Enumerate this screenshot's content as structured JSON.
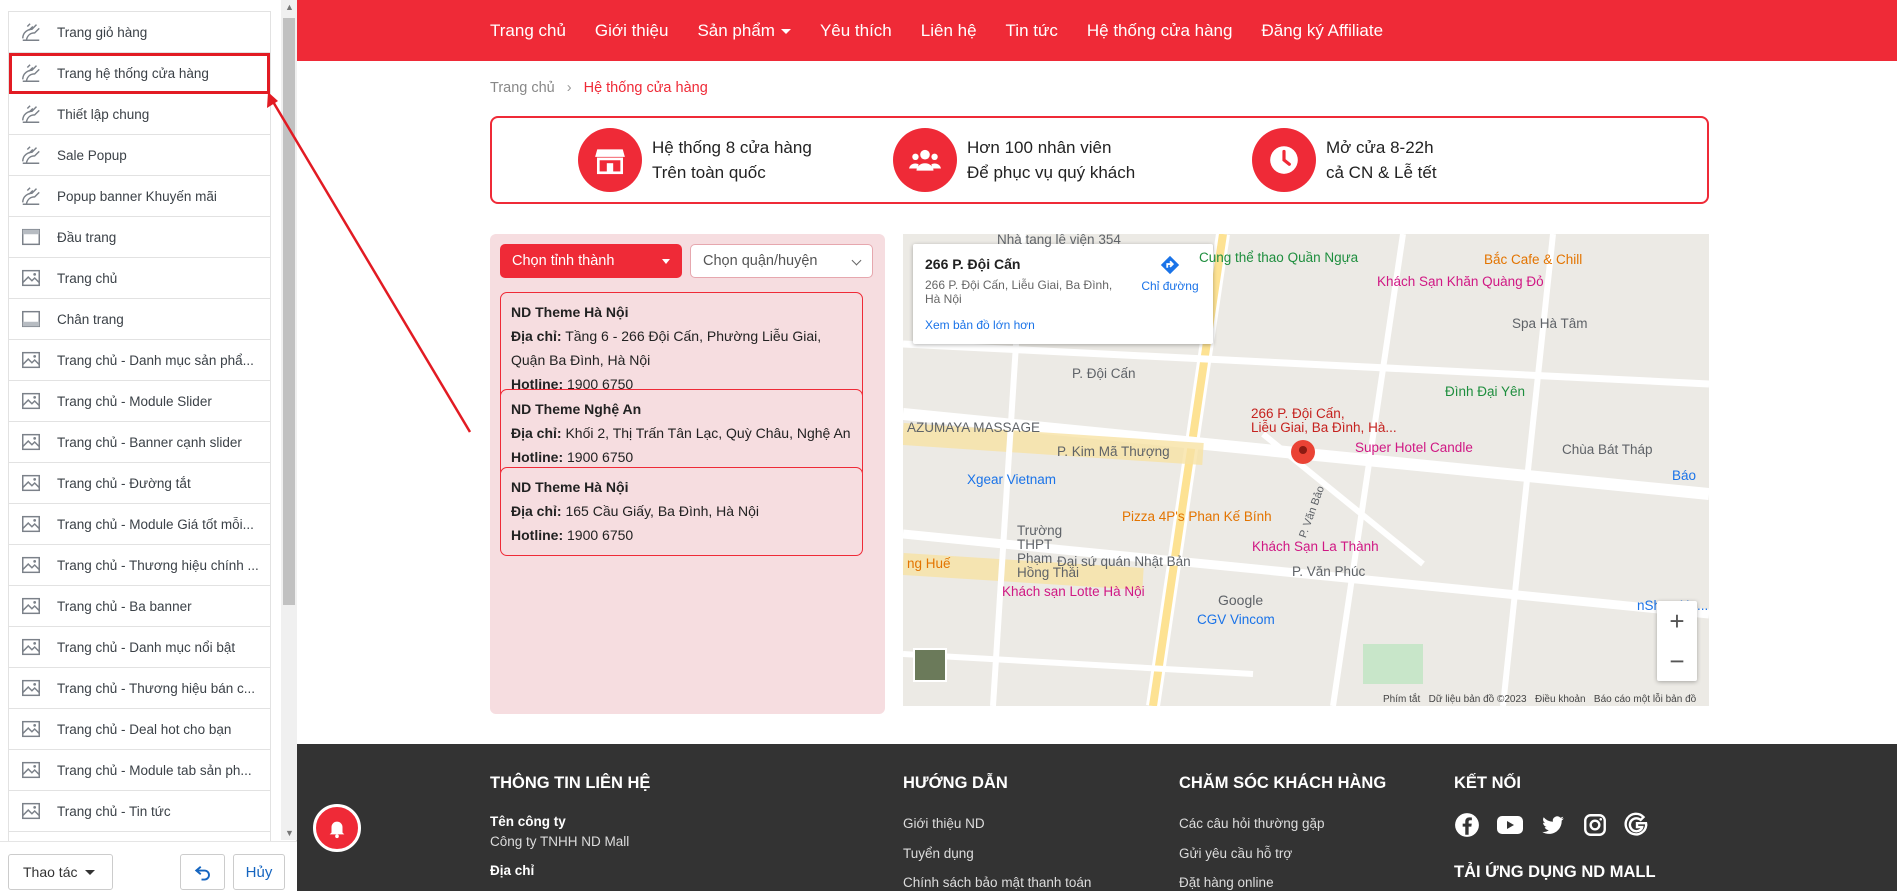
{
  "sidebar": {
    "sections": [
      {
        "label": "Trang giỏ hàng",
        "icon": "layout-icon"
      },
      {
        "label": "Trang hệ thống cửa hàng",
        "icon": "layout-icon"
      },
      {
        "label": "Thiết lập chung",
        "icon": "layout-icon"
      },
      {
        "label": "Sale Popup",
        "icon": "layout-icon"
      },
      {
        "label": "Popup banner Khuyến mãi",
        "icon": "layout-icon"
      },
      {
        "label": "Đầu trang",
        "icon": "header-icon"
      },
      {
        "label": "Trang chủ",
        "icon": "image-icon"
      },
      {
        "label": "Chân trang",
        "icon": "footer-icon"
      },
      {
        "label": "Trang chủ - Danh mục sản phẩ...",
        "icon": "image-icon"
      },
      {
        "label": "Trang chủ - Module Slider",
        "icon": "image-icon"
      },
      {
        "label": "Trang chủ - Banner cạnh slider",
        "icon": "image-icon"
      },
      {
        "label": "Trang chủ - Đường tắt",
        "icon": "image-icon"
      },
      {
        "label": "Trang chủ - Module Giá tốt mỗi...",
        "icon": "image-icon"
      },
      {
        "label": "Trang chủ - Thương hiệu chính ...",
        "icon": "image-icon"
      },
      {
        "label": "Trang chủ - Ba banner",
        "icon": "image-icon"
      },
      {
        "label": "Trang chủ - Danh mục nổi bật",
        "icon": "image-icon"
      },
      {
        "label": "Trang chủ - Thương hiệu bán c...",
        "icon": "image-icon"
      },
      {
        "label": "Trang chủ - Deal hot cho bạn",
        "icon": "image-icon"
      },
      {
        "label": "Trang chủ - Module tab sản ph...",
        "icon": "image-icon"
      },
      {
        "label": "Trang chủ - Tin tức",
        "icon": "image-icon"
      }
    ],
    "highlighted": "Trang hệ thống cửa hàng",
    "actions_label": "Thao tác",
    "cancel_label": "Hủy"
  },
  "nav": {
    "items": [
      "Trang chủ",
      "Giới thiệu",
      "Sản phẩm",
      "Yêu thích",
      "Liên hệ",
      "Tin tức",
      "Hệ thống cửa hàng",
      "Đăng ký Affiliate"
    ]
  },
  "breadcrumb": {
    "home": "Trang chủ",
    "separator": "›",
    "current": "Hệ thống cửa hàng"
  },
  "features": [
    {
      "line1": "Hệ thống 8 cửa hàng",
      "line2": "Trên toàn quốc",
      "icon": "store-icon"
    },
    {
      "line1": "Hơn 100 nhân viên",
      "line2": "Để phục vụ quý khách",
      "icon": "users-icon"
    },
    {
      "line1": "Mở cửa 8-22h",
      "line2": "cả CN & Lễ tết",
      "icon": "clock-icon"
    }
  ],
  "store_filter": {
    "province_placeholder": "Chọn tỉnh thành",
    "district_placeholder": "Chọn quận/huyện"
  },
  "stores": [
    {
      "name": "ND Theme Hà Nội",
      "address_label": "Địa chỉ:",
      "address": "Tầng 6 - 266 Đội Cấn, Phường Liễu Giai, Quận Ba Đình, Hà Nội",
      "hotline_label": "Hotline:",
      "hotline": "1900 6750"
    },
    {
      "name": "ND Theme Nghệ An",
      "address_label": "Địa chỉ:",
      "address": "Khối 2, Thị Trấn Tân Lạc, Quỳ Châu, Nghệ An",
      "hotline_label": "Hotline:",
      "hotline": "1900 6750"
    },
    {
      "name": "ND Theme Hà Nội",
      "address_label": "Địa chỉ:",
      "address": "165 Cầu Giấy, Ba Đình, Hà Nội",
      "hotline_label": "Hotline:",
      "hotline": "1900 6750"
    }
  ],
  "map": {
    "card_title": "266 P. Đội Cấn",
    "card_address": "266 P. Đội Cấn, Liễu Giai, Ba Đình, Hà Nội",
    "directions": "Chỉ đường",
    "larger_map": "Xem bản đồ lớn hơn",
    "pin_label_1": "266 P. Đội Cấn,",
    "pin_label_2": "Liễu Giai, Ba Đình, Hà...",
    "places": [
      "Cung thể thao Quần Ngựa",
      "Bắc Cafe & Chill",
      "Khách Sạn Khăn Quàng Đỏ",
      "Spa Hà Tâm",
      "P. Đội Cấn",
      "Đình Đại Yên",
      "AZUMAYA MASSAGE",
      "P. Kim Mã Thượng",
      "Super Hotel Candle",
      "Chùa Bát Tháp",
      "Xgear Vietnam",
      "Pizza 4P's Phan Kế Bính",
      "Trường THPT Phạm Hồng Thái",
      "Đại sứ quán Nhật Bản",
      "Khách Sạn La Thành",
      "P. Văn Phúc",
      "Khách sạn Lotte Hà Nội",
      "CGV Vincom",
      "Nhà tang lễ viện 354",
      "P. Văn Bảo",
      "Báo",
      "ng Huế",
      "nShop Ha..."
    ],
    "google": "Google",
    "footer_links": [
      "Phím tắt",
      "Dữ liệu bản đồ ©2023",
      "Điều khoản",
      "Báo cáo một lỗi bản đồ"
    ],
    "zoom_in": "+",
    "zoom_out": "−"
  },
  "footer": {
    "col1_title": "THÔNG TIN LIÊN HỆ",
    "company_label": "Tên công ty",
    "company": "Công ty TNHH ND Mall",
    "address_label": "Địa chỉ",
    "col2_title": "HƯỚNG DẪN",
    "col2_links": [
      "Giới thiệu ND",
      "Tuyển dụng",
      "Chính sách bảo mật thanh toán"
    ],
    "col3_title": "CHĂM SÓC KHÁCH HÀNG",
    "col3_links": [
      "Các câu hỏi thường gặp",
      "Gửi yêu cầu hỗ trợ",
      "Đặt hàng online"
    ],
    "col4_title": "KẾT NỐI",
    "social": [
      "facebook-icon",
      "youtube-icon",
      "twitter-icon",
      "instagram-icon",
      "google-icon"
    ],
    "app_title": "TẢI ỨNG DỤNG ND MALL"
  },
  "colors": {
    "accent": "#ef2a37",
    "footer_bg": "#333333",
    "panel_bg": "#f6dde0"
  }
}
